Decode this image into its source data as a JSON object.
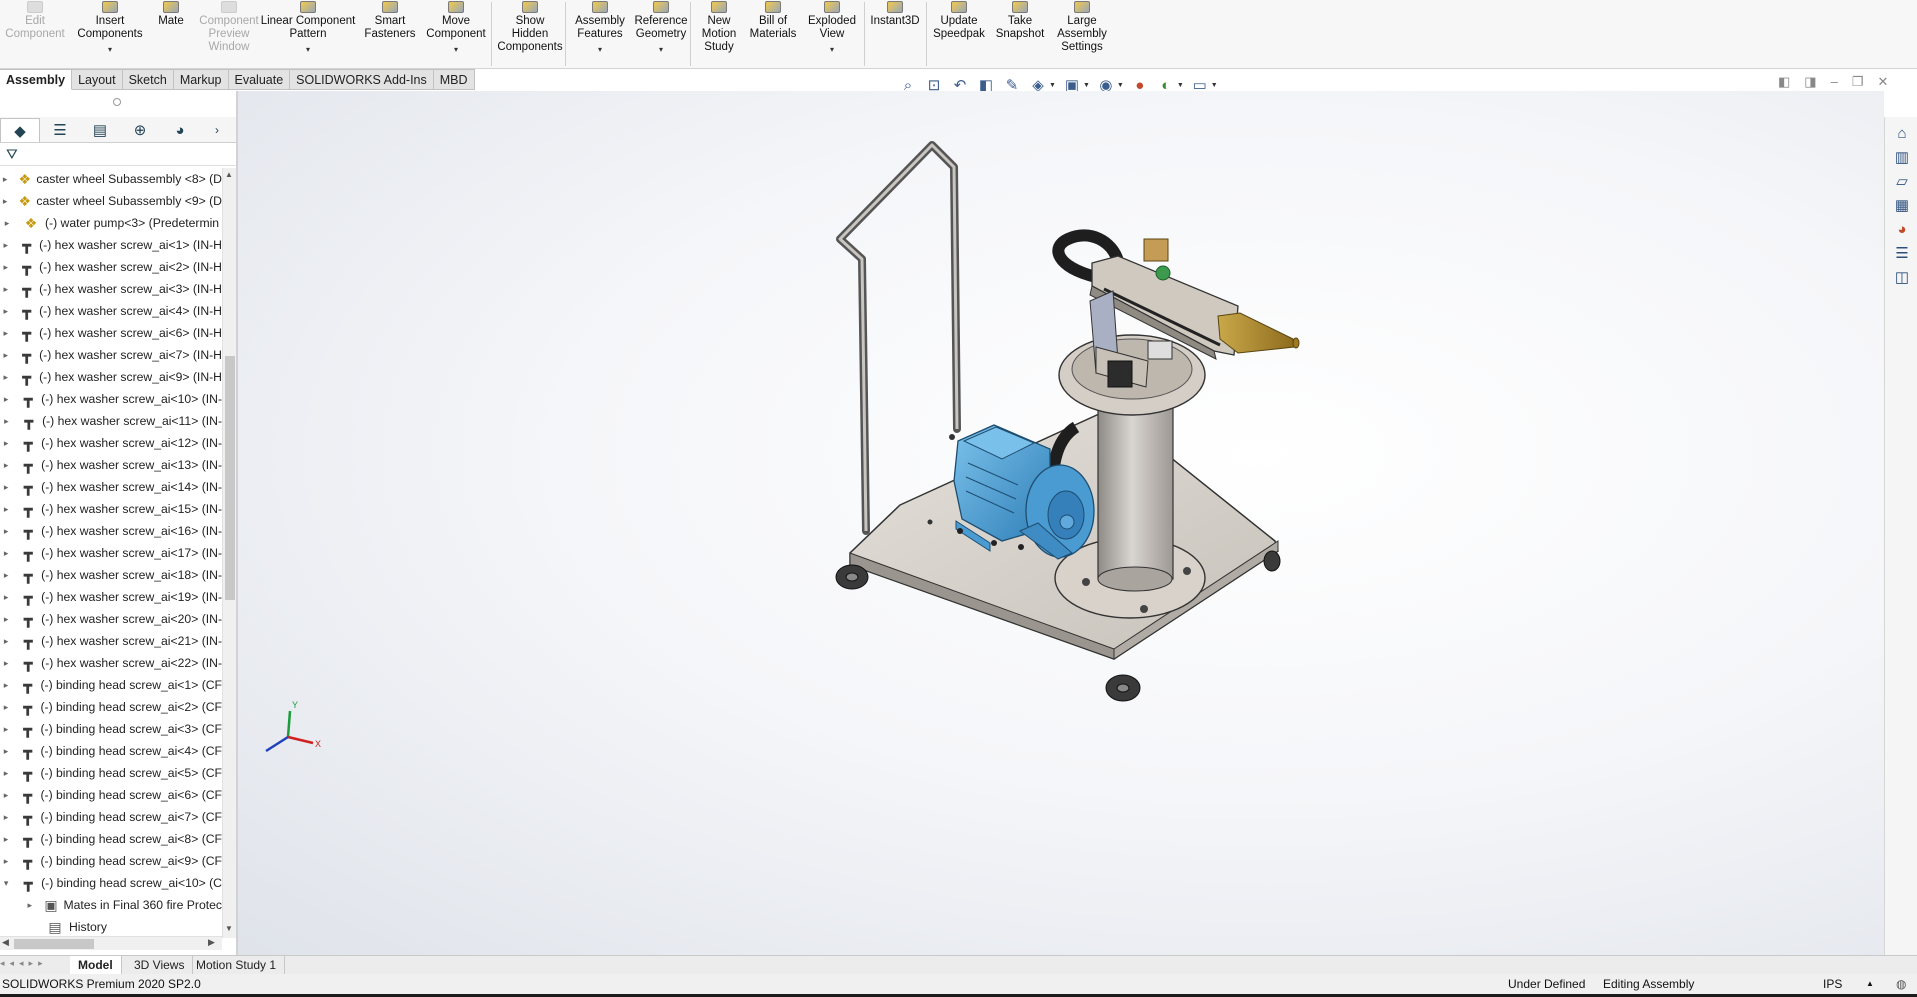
{
  "ribbon": {
    "commands": [
      {
        "name": "edit-component-button",
        "label": "Edit\nComponent",
        "disabled": true,
        "dropdown": false
      },
      {
        "name": "insert-components-button",
        "label": "Insert\nComponents",
        "disabled": false,
        "dropdown": true
      },
      {
        "name": "mate-button",
        "label": "Mate",
        "disabled": false,
        "dropdown": false
      },
      {
        "name": "component-preview-window-button",
        "label": "Component\nPreview\nWindow",
        "disabled": true,
        "dropdown": false
      },
      {
        "name": "linear-component-pattern-button",
        "label": "Linear Component\nPattern",
        "disabled": false,
        "dropdown": true
      },
      {
        "name": "smart-fasteners-button",
        "label": "Smart\nFasteners",
        "disabled": false,
        "dropdown": false
      },
      {
        "name": "move-component-button",
        "label": "Move\nComponent",
        "disabled": false,
        "dropdown": true
      },
      {
        "name": "show-hidden-components-button",
        "label": "Show\nHidden\nComponents",
        "disabled": false,
        "dropdown": false
      },
      {
        "name": "assembly-features-button",
        "label": "Assembly\nFeatures",
        "disabled": false,
        "dropdown": true
      },
      {
        "name": "reference-geometry-button",
        "label": "Reference\nGeometry",
        "disabled": false,
        "dropdown": true
      },
      {
        "name": "new-motion-study-button",
        "label": "New\nMotion\nStudy",
        "disabled": false,
        "dropdown": false
      },
      {
        "name": "bill-of-materials-button",
        "label": "Bill of\nMaterials",
        "disabled": false,
        "dropdown": false
      },
      {
        "name": "exploded-view-button",
        "label": "Exploded\nView",
        "disabled": false,
        "dropdown": true
      },
      {
        "name": "instant3d-button",
        "label": "Instant3D",
        "disabled": false,
        "dropdown": false
      },
      {
        "name": "update-speedpak-button",
        "label": "Update\nSpeedpak",
        "disabled": false,
        "dropdown": false
      },
      {
        "name": "take-snapshot-button",
        "label": "Take\nSnapshot",
        "disabled": false,
        "dropdown": false
      },
      {
        "name": "large-assembly-settings-button",
        "label": "Large\nAssembly\nSettings",
        "disabled": false,
        "dropdown": false
      }
    ]
  },
  "tabs": [
    "Assembly",
    "Layout",
    "Sketch",
    "Markup",
    "Evaluate",
    "SOLIDWORKS Add-Ins",
    "MBD"
  ],
  "active_tab": "Assembly",
  "feature_tree": {
    "items": [
      {
        "label": "caster wheel Subassembly <8> (D",
        "icon": "subassembly-icon",
        "expander": "▸"
      },
      {
        "label": "caster wheel Subassembly <9> (D",
        "icon": "subassembly-icon",
        "expander": "▸"
      },
      {
        "label": "(-) water pump<3> (Predetermin",
        "icon": "subassembly-icon",
        "expander": "▸"
      },
      {
        "label": "(-) hex washer screw_ai<1> (IN-H",
        "icon": "screw-icon",
        "expander": "▸"
      },
      {
        "label": "(-) hex washer screw_ai<2> (IN-H",
        "icon": "screw-icon",
        "expander": "▸"
      },
      {
        "label": "(-) hex washer screw_ai<3> (IN-H",
        "icon": "screw-icon",
        "expander": "▸"
      },
      {
        "label": "(-) hex washer screw_ai<4> (IN-H",
        "icon": "screw-icon",
        "expander": "▸"
      },
      {
        "label": "(-) hex washer screw_ai<6> (IN-H",
        "icon": "screw-icon",
        "expander": "▸"
      },
      {
        "label": "(-) hex washer screw_ai<7> (IN-H",
        "icon": "screw-icon",
        "expander": "▸"
      },
      {
        "label": "(-) hex washer screw_ai<9> (IN-H",
        "icon": "screw-icon",
        "expander": "▸"
      },
      {
        "label": "(-) hex washer screw_ai<10> (IN-",
        "icon": "screw-icon",
        "expander": "▸"
      },
      {
        "label": "(-) hex washer screw_ai<11> (IN-",
        "icon": "screw-icon",
        "expander": "▸"
      },
      {
        "label": "(-) hex washer screw_ai<12> (IN-",
        "icon": "screw-icon",
        "expander": "▸"
      },
      {
        "label": "(-) hex washer screw_ai<13> (IN-",
        "icon": "screw-icon",
        "expander": "▸"
      },
      {
        "label": "(-) hex washer screw_ai<14> (IN-",
        "icon": "screw-icon",
        "expander": "▸"
      },
      {
        "label": "(-) hex washer screw_ai<15> (IN-",
        "icon": "screw-icon",
        "expander": "▸"
      },
      {
        "label": "(-) hex washer screw_ai<16> (IN-",
        "icon": "screw-icon",
        "expander": "▸"
      },
      {
        "label": "(-) hex washer screw_ai<17> (IN-",
        "icon": "screw-icon",
        "expander": "▸"
      },
      {
        "label": "(-) hex washer screw_ai<18> (IN-",
        "icon": "screw-icon",
        "expander": "▸"
      },
      {
        "label": "(-) hex washer screw_ai<19> (IN-",
        "icon": "screw-icon",
        "expander": "▸"
      },
      {
        "label": "(-) hex washer screw_ai<20> (IN-",
        "icon": "screw-icon",
        "expander": "▸"
      },
      {
        "label": "(-) hex washer screw_ai<21> (IN-",
        "icon": "screw-icon",
        "expander": "▸"
      },
      {
        "label": "(-) hex washer screw_ai<22> (IN-",
        "icon": "screw-icon",
        "expander": "▸"
      },
      {
        "label": "(-) binding head screw_ai<1> (CF",
        "icon": "screw-icon",
        "expander": "▸"
      },
      {
        "label": "(-) binding head screw_ai<2> (CF",
        "icon": "screw-icon",
        "expander": "▸"
      },
      {
        "label": "(-) binding head screw_ai<3> (CF",
        "icon": "screw-icon",
        "expander": "▸"
      },
      {
        "label": "(-) binding head screw_ai<4> (CF",
        "icon": "screw-icon",
        "expander": "▸"
      },
      {
        "label": "(-) binding head screw_ai<5> (CF",
        "icon": "screw-icon",
        "expander": "▸"
      },
      {
        "label": "(-) binding head screw_ai<6> (CF",
        "icon": "screw-icon",
        "expander": "▸"
      },
      {
        "label": "(-) binding head screw_ai<7> (CF",
        "icon": "screw-icon",
        "expander": "▸"
      },
      {
        "label": "(-) binding head screw_ai<8> (CF",
        "icon": "screw-icon",
        "expander": "▸"
      },
      {
        "label": "(-) binding head screw_ai<9> (CF",
        "icon": "screw-icon",
        "expander": "▸"
      },
      {
        "label": "(-) binding head screw_ai<10> (C",
        "icon": "screw-icon",
        "expander": "▾"
      },
      {
        "label": "Mates in Final 360 fire Protec",
        "icon": "mates-folder-icon",
        "expander": "▸"
      },
      {
        "label": "History",
        "icon": "history-icon",
        "expander": ""
      }
    ]
  },
  "bottom_tabs": [
    "Model",
    "3D Views",
    "Motion Study 1"
  ],
  "active_bottom_tab": "Model",
  "status": {
    "product": "SOLIDWORKS Premium 2020 SP2.0",
    "definition": "Under Defined",
    "mode": "Editing Assembly",
    "units": "IPS"
  },
  "colors": {
    "pump_blue": "#4a9bd1",
    "base_plate": "#d6d1c9",
    "nozzle_brass": "#b9973d"
  }
}
